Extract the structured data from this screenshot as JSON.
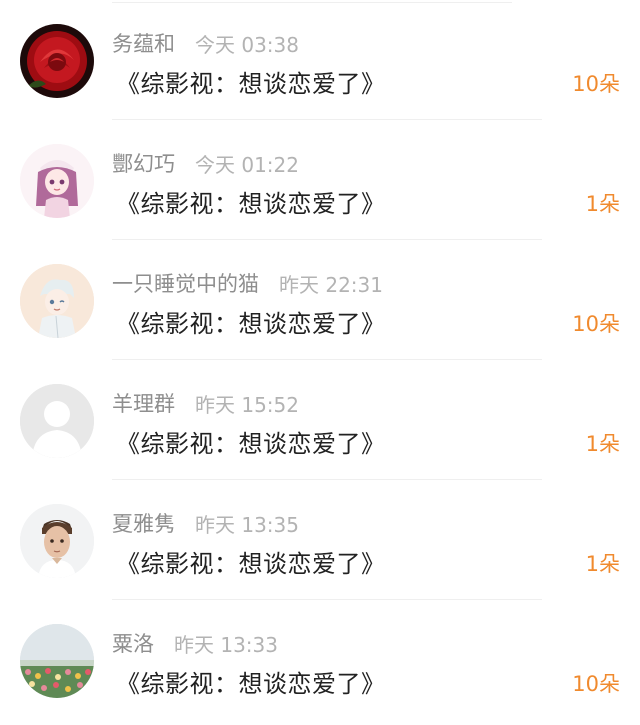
{
  "colors": {
    "name": "#8e8e8e",
    "time": "#b3b3b3",
    "title": "#222222",
    "count": "#f08a2e",
    "divider": "#efefef"
  },
  "items": [
    {
      "name": "务蕴和",
      "time": "今天 03:38",
      "title": "《综影视：想谈恋爱了》",
      "count": "10朵",
      "avatar": "red-rose"
    },
    {
      "name": "酆幻巧",
      "time": "今天 01:22",
      "title": "《综影视：想谈恋爱了》",
      "count": "1朵",
      "avatar": "anime-girl-pink-hair"
    },
    {
      "name": "一只睡觉中的猫",
      "time": "昨天 22:31",
      "title": "《综影视：想谈恋爱了》",
      "count": "10朵",
      "avatar": "anime-boy-white-hair"
    },
    {
      "name": "羊理群",
      "time": "昨天 15:52",
      "title": "《综影视：想谈恋爱了》",
      "count": "1朵",
      "avatar": "default-user"
    },
    {
      "name": "夏雅隽",
      "time": "昨天 13:35",
      "title": "《综影视：想谈恋爱了》",
      "count": "1朵",
      "avatar": "young-man-portrait"
    },
    {
      "name": "粟洛",
      "time": "昨天 13:33",
      "title": "《综影视：想谈恋爱了》",
      "count": "10朵",
      "avatar": "tulip-field"
    }
  ]
}
